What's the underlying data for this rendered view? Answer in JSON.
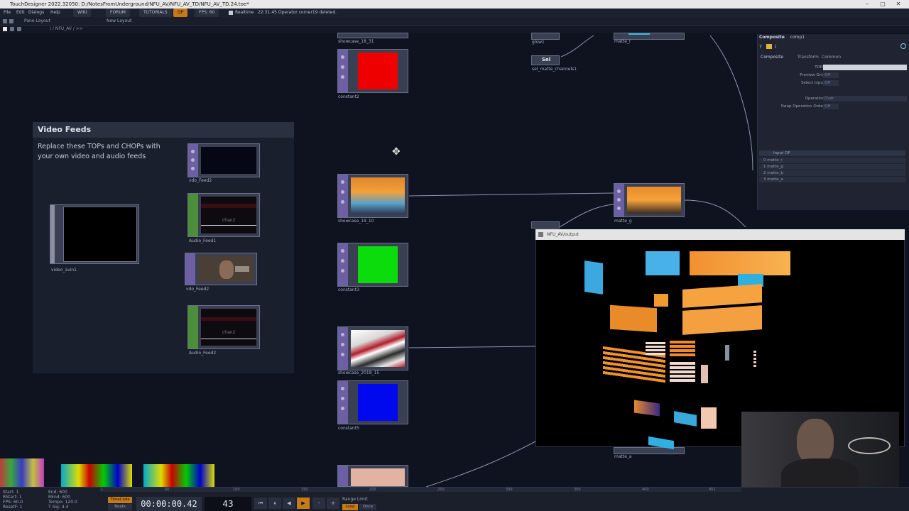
{
  "window": {
    "title": "TouchDesigner 2022.32050: D:/NotesFromUnderground/NFU_AV/NFU_AV_TD/NFU_AV_TD.24.toe*",
    "controls": [
      "–",
      "▢",
      "✕"
    ]
  },
  "menu": {
    "items": [
      "File",
      "Edit",
      "Dialogs",
      "Help"
    ],
    "links": [
      "WIKI",
      "FORUM",
      "TUTORIALS"
    ],
    "oplink": "OP",
    "fps": "FPS: 60",
    "realtime": "Realtime",
    "status": "22:31:45 Operator corner19 deleted."
  },
  "panebar": {
    "pane_layout": "Pane Layout",
    "new_layout": "New Layout"
  },
  "path": {
    "text": "/  /  NFU_AV  /  >>"
  },
  "comment": {
    "title": "Video Feeds",
    "text": "Replace these TOPs and CHOPs with\nyour own video and audio feeds"
  },
  "nodes": {
    "video_avin": "video_avin1",
    "vdo_feed2": "vdo_Feed2",
    "audio_feed1": "Audio_Feed1",
    "vdo_feed2b": "vdo_Feed2",
    "audio_feed2": "Audio_Feed2",
    "chan_label": "chan2",
    "showcase_18": "showcase_18_31",
    "constant2": "constant2",
    "showcase_19": "showcase_19_10",
    "constant3": "constant3",
    "showcase_2018": "showcase_2018_15",
    "constant5": "constant5",
    "sel_label": "Sel",
    "sel_name": "sel_matte_channels1",
    "matte_r": "matte_r",
    "matte_g": "matte_g",
    "matte_a": "matte_a",
    "glow": "glow1"
  },
  "params": {
    "header_type": "Composite",
    "header_name": "comp1",
    "tabs": [
      "Composite",
      "Transform",
      "Common"
    ],
    "rows": [
      {
        "label": "TOPs",
        "value": ""
      },
      {
        "label": "Preview Grid",
        "value": "Off"
      },
      {
        "label": "Select Input",
        "value": "Off"
      },
      {
        "label": "Operation",
        "value": "Over"
      },
      {
        "label": "Swap Operation Order",
        "value": "Off"
      }
    ],
    "input_header": "Input OP",
    "inputs": [
      "0  matte_r",
      "1  matte_g",
      "2  matte_b",
      "3  matte_a"
    ]
  },
  "viewer": {
    "title": "NFU_AV/output"
  },
  "timeline": {
    "start_label": "Start:",
    "start_val": "1",
    "end_label": "End:",
    "end_val": "600",
    "rstart_label": "RStart:",
    "rstart_val": "1",
    "rend_label": "REnd:",
    "rend_val": "600",
    "fps_label": "FPS:",
    "fps_val": "60.0",
    "tempo_label": "Tempo:",
    "tempo_val": "120.0",
    "reset_label": "ResetF:",
    "reset_val": "1",
    "tsig_label": "T Sig:",
    "tsig_val": "4   4",
    "timecode_label": "TimeCode",
    "beats_label": "Beats",
    "timecode": "00:00:00.42",
    "frame": "43",
    "range_label": "Range Limit",
    "loop": "Loop",
    "once": "Once",
    "ticks": [
      "1",
      "50",
      "100",
      "150",
      "200",
      "250",
      "300",
      "350",
      "400",
      "451"
    ]
  }
}
